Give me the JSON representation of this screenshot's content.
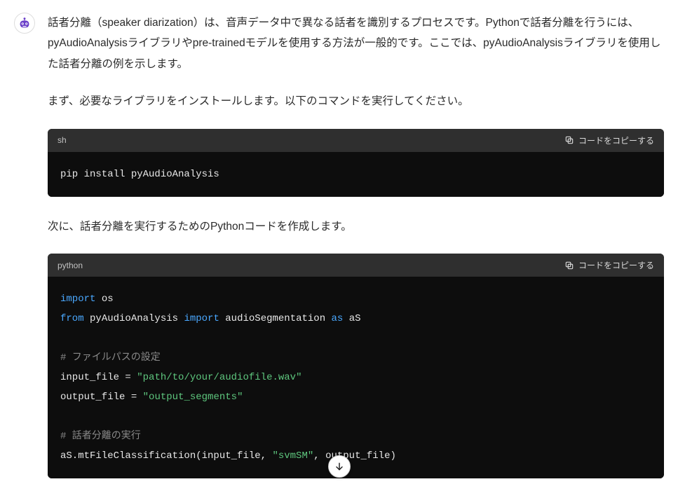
{
  "copy_label": "コードをコピーする",
  "paragraphs": {
    "p1": "話者分離（speaker diarization）は、音声データ中で異なる話者を識別するプロセスです。Pythonで話者分離を行うには、pyAudioAnalysisライブラリやpre-trainedモデルを使用する方法が一般的です。ここでは、pyAudioAnalysisライブラリを使用した話者分離の例を示します。",
    "p2": "まず、必要なライブラリをインストールします。以下のコマンドを実行してください。",
    "p3": "次に、話者分離を実行するためのPythonコードを作成します。"
  },
  "code1": {
    "lang": "sh",
    "text": "pip install pyAudioAnalysis"
  },
  "code2": {
    "lang": "python",
    "tokens": {
      "import": "import",
      "os": "os",
      "from": "from",
      "pyAudioAnalysis": "pyAudioAnalysis",
      "audioSegmentation": "audioSegmentation",
      "as": "as",
      "aS": "aS",
      "cmt1": "# ファイルパスの設定",
      "inputfile": "input_file",
      "eq": " = ",
      "path1": "\"path/to/your/audiofile.wav\"",
      "outputfile": "output_file",
      "path2": "\"output_segments\"",
      "cmt2": "# 話者分離の実行",
      "call_left": "aS.mtFileClassification(input_file, ",
      "svms": "\"svmSM\"",
      "call_right": ", output_file)"
    }
  },
  "icons": {
    "avatar": "robot-assistant-icon",
    "copy": "copy-icon",
    "scroll": "arrow-down-icon"
  }
}
